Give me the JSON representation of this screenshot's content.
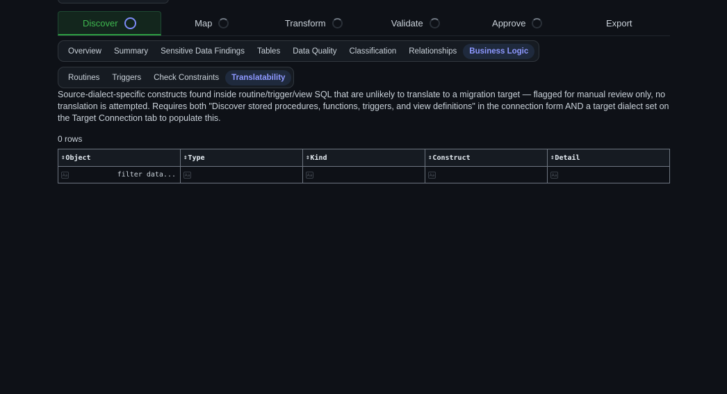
{
  "stepper": {
    "steps": [
      {
        "label": "Discover",
        "state": "active"
      },
      {
        "label": "Map",
        "state": "pending"
      },
      {
        "label": "Transform",
        "state": "pending"
      },
      {
        "label": "Validate",
        "state": "pending"
      },
      {
        "label": "Approve",
        "state": "pending"
      },
      {
        "label": "Export",
        "state": "none"
      }
    ]
  },
  "primary_tabs": {
    "items": [
      {
        "label": "Overview"
      },
      {
        "label": "Summary"
      },
      {
        "label": "Sensitive Data Findings"
      },
      {
        "label": "Tables"
      },
      {
        "label": "Data Quality"
      },
      {
        "label": "Classification"
      },
      {
        "label": "Relationships"
      },
      {
        "label": "Business Logic"
      }
    ],
    "selected": "Business Logic"
  },
  "secondary_tabs": {
    "items": [
      {
        "label": "Routines"
      },
      {
        "label": "Triggers"
      },
      {
        "label": "Check Constraints"
      },
      {
        "label": "Translatability"
      }
    ],
    "selected": "Translatability"
  },
  "description": "Source-dialect-specific constructs found inside routine/trigger/view SQL that are unlikely to translate to a migration target — flagged for manual review only, no translation is attempted. Requires both \"Discover stored procedures, functions, triggers, and view definitions\" in the connection form AND a target dialect set on the Target Connection tab to populate this.",
  "row_count": "0 rows",
  "table": {
    "sort_glyph": "⇕",
    "columns": [
      {
        "label": "Object"
      },
      {
        "label": "Type"
      },
      {
        "label": "Kind"
      },
      {
        "label": "Construct"
      },
      {
        "label": "Detail"
      }
    ],
    "filter_icon_text": "Aa",
    "filter_placeholder": "filter data..."
  },
  "colors": {
    "background": "#0e1117",
    "active_step": "#3fb950",
    "selected_tab": "#8d98ff",
    "border": "#30363d"
  }
}
